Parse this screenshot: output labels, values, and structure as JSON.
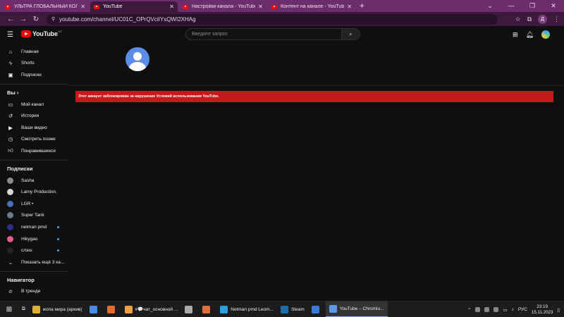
{
  "browser": {
    "tabs": [
      {
        "title": "УЛЬТРА ГЛОБАЛЬНЫЙ КОЛЛАП",
        "active": false
      },
      {
        "title": "YouTube",
        "active": true
      },
      {
        "title": "Настройки канала - YouTube St",
        "active": false
      },
      {
        "title": "Контент на канале - YouTube St",
        "active": false
      }
    ],
    "new_tab": "+",
    "url": "youtube.com/channel/UC01C_OPrQVciIYsQWI2XHAg",
    "profile_letter": "Д"
  },
  "header": {
    "logo_text": "YouTube",
    "logo_country": "KZ",
    "search_placeholder": "Введите запрос"
  },
  "sidebar": {
    "main": [
      {
        "label": "Главная",
        "icon": "home-icon"
      },
      {
        "label": "Shorts",
        "icon": "shorts-icon"
      },
      {
        "label": "Подписки",
        "icon": "subscriptions-icon"
      }
    ],
    "you_heading": "Вы",
    "you_items": [
      {
        "label": "Мой канал",
        "icon": "channel-icon"
      },
      {
        "label": "История",
        "icon": "history-icon"
      },
      {
        "label": "Ваши видео",
        "icon": "videos-icon"
      },
      {
        "label": "Смотреть позже",
        "icon": "watch-later-icon"
      },
      {
        "label": "Понравившиеся",
        "icon": "like-icon"
      }
    ],
    "subs_heading": "Подписки",
    "subscriptions": [
      {
        "label": "Sasha",
        "color": "#8a8a8a",
        "dot": false
      },
      {
        "label": "Larny Production.",
        "color": "#d9d9d9",
        "dot": false
      },
      {
        "label": "LGR •",
        "color": "#4a6fb3",
        "dot": false
      },
      {
        "label": "Super Tank",
        "color": "#6c7a8a",
        "dot": false
      },
      {
        "label": "netman pmd",
        "color": "#2d2d8a",
        "dot": true
      },
      {
        "label": "Hikygao",
        "color": "#e85a8a",
        "dot": true
      },
      {
        "label": "слэш",
        "color": "#222222",
        "dot": true
      }
    ],
    "show_more": "Показать ещё 3 ка...",
    "nav_heading": "Навигатор",
    "nav_items": [
      {
        "label": "В тренде",
        "icon": "trending-icon"
      }
    ]
  },
  "main": {
    "banner_text": "Этот аккаунт заблокирован за нарушение Условий использования YouTube."
  },
  "taskbar": {
    "apps": [
      {
        "label": "жопа мира (архив)",
        "color": "#e0b030",
        "active": false
      },
      {
        "label": "",
        "color": "#4a8ae8",
        "active": false
      },
      {
        "label": "",
        "color": "#e86a2a",
        "active": false
      },
      {
        "label": "#💬чат_основной ...",
        "color": "#f0a040",
        "active": false
      },
      {
        "label": "",
        "color": "#aaaaaa",
        "active": false
      },
      {
        "label": "",
        "color": "#e0703a",
        "active": false
      },
      {
        "label": "Netman pmd Leom...",
        "color": "#2aa0e0",
        "active": false
      },
      {
        "label": "Steam",
        "color": "#1b6ea8",
        "active": false
      },
      {
        "label": "",
        "color": "#3a7ad8",
        "active": false
      },
      {
        "label": "YouTube – Chromiu...",
        "color": "#5a9ae8",
        "active": true
      }
    ],
    "lang": "РУС",
    "time": "23:19",
    "date": "15.11.2023"
  }
}
